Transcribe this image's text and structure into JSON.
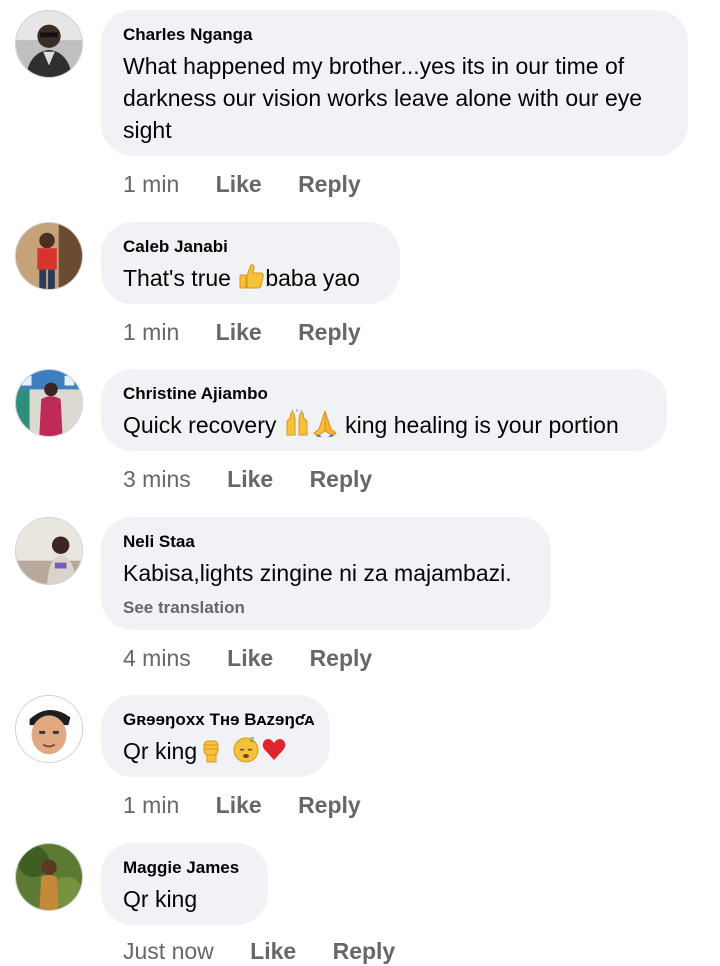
{
  "comments": [
    {
      "author": "Charles Nganga",
      "text": "What happened my brother...yes its in our time of darkness our vision works leave alone with our eye sight",
      "time": "1 min",
      "like": "Like",
      "reply": "Reply"
    },
    {
      "author": "Caleb Janabi",
      "text_before": "That's true ",
      "emoji": "thumbs-up-icon",
      "text_after": "baba yao",
      "time": "1 min",
      "like": "Like",
      "reply": "Reply"
    },
    {
      "author": "Christine Ajiambo",
      "text_before": "Quick recovery ",
      "emojis": [
        "raised-hands-icon",
        "folded-hands-icon"
      ],
      "text_after": " king healing is your portion",
      "time": "3 mins",
      "like": "Like",
      "reply": "Reply"
    },
    {
      "author": "Neli Staa",
      "text": "Kabisa,lights zingine ni za majambazi.",
      "see_translation": "See translation",
      "time": "4 mins",
      "like": "Like",
      "reply": "Reply"
    },
    {
      "author": "Gʀɘɘŋoxx Tʜɘ Bᴀzɘŋƈᴀ",
      "text_before": "Qr king",
      "emojis": [
        "raised-fist-icon",
        "sleeping-face-icon",
        "red-heart-icon"
      ],
      "time": "1 min",
      "like": "Like",
      "reply": "Reply"
    },
    {
      "author": "Maggie James",
      "text": "Qr king",
      "time": "Just now",
      "like": "Like",
      "reply": "Reply"
    }
  ],
  "colors": {
    "bubble": "#f0f2f5",
    "meta": "#65676b",
    "text": "#050505"
  }
}
